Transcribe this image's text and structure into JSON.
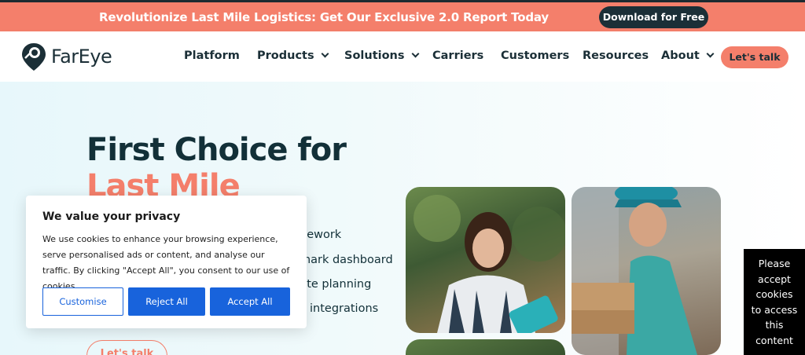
{
  "promo": {
    "text": "Revolutionize Last Mile Logistics: Get Our Exclusive 2.0 Report Today",
    "button": "Download for Free"
  },
  "nav": {
    "logo_text": "FarEye",
    "items": [
      {
        "label": "Platform",
        "has_dropdown": false
      },
      {
        "label": "Products",
        "has_dropdown": true
      },
      {
        "label": "Solutions",
        "has_dropdown": true
      },
      {
        "label": "Carriers",
        "has_dropdown": false
      },
      {
        "label": "Customers",
        "has_dropdown": false
      },
      {
        "label": "Resources",
        "has_dropdown": false
      },
      {
        "label": "About",
        "has_dropdown": true
      }
    ],
    "cta": "Let's talk"
  },
  "hero": {
    "headline_line1": "First Choice for",
    "headline_line2": "Last Mile",
    "features": [
      "nework",
      "mark dashboard",
      "ute planning",
      "integrations"
    ],
    "cta": "Let's talk"
  },
  "cookie": {
    "title": "We value your privacy",
    "body": "We use cookies to enhance your browsing experience, serve personalised ads or content, and analyse our traffic. By clicking \"Accept All\", you consent to our use of cookies.",
    "customise": "Customise",
    "reject": "Reject All",
    "accept": "Accept All"
  },
  "notice": {
    "lines": [
      "Please",
      "accept",
      "cookies",
      "to access",
      "this",
      "content"
    ]
  },
  "colors": {
    "brand_coral": "#f47f6b",
    "brand_dark": "#1b2f37",
    "cookie_blue": "#1863dc"
  }
}
